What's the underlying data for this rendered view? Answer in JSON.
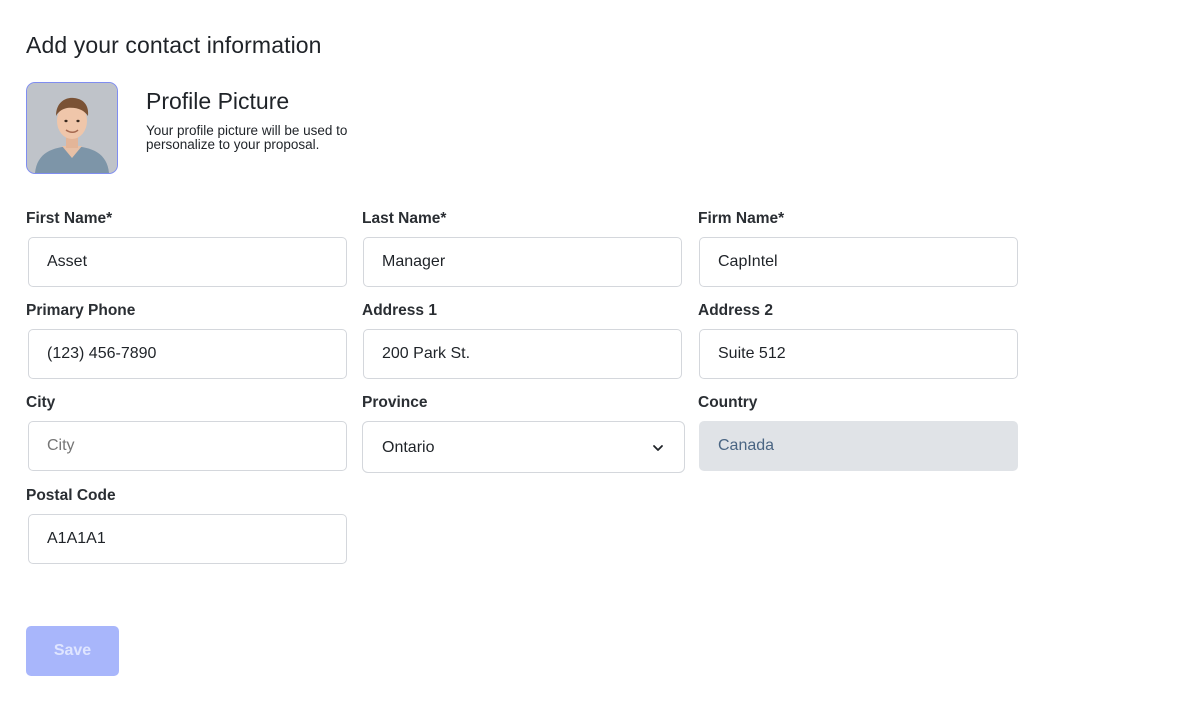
{
  "page": {
    "title": "Add your contact information"
  },
  "profile": {
    "title": "Profile Picture",
    "description": "Your profile picture will be used to personalize to your proposal.",
    "avatar_icon": "person-photo-icon"
  },
  "form": {
    "first_name": {
      "label": "First Name*",
      "value": "Asset"
    },
    "last_name": {
      "label": "Last Name*",
      "value": "Manager"
    },
    "firm_name": {
      "label": "Firm Name*",
      "value": "CapIntel"
    },
    "primary_phone": {
      "label": "Primary Phone",
      "value": "(123) 456-7890"
    },
    "address_1": {
      "label": "Address 1",
      "value": "200 Park St."
    },
    "address_2": {
      "label": "Address 2",
      "value": "Suite 512"
    },
    "city": {
      "label": "City",
      "value": "",
      "placeholder": "City"
    },
    "province": {
      "label": "Province",
      "value": "Ontario",
      "icon": "chevron-down-icon"
    },
    "country": {
      "label": "Country",
      "value": "Canada",
      "disabled": true
    },
    "postal_code": {
      "label": "Postal Code",
      "value": "A1A1A1"
    }
  },
  "actions": {
    "save_label": "Save",
    "save_disabled": true
  },
  "colors": {
    "accent_border": "#7f8df0",
    "save_button_bg": "#a8b6fb",
    "save_button_text": "#dfe5ff",
    "disabled_field_bg": "#e0e3e7",
    "disabled_field_text": "#4a6583"
  }
}
